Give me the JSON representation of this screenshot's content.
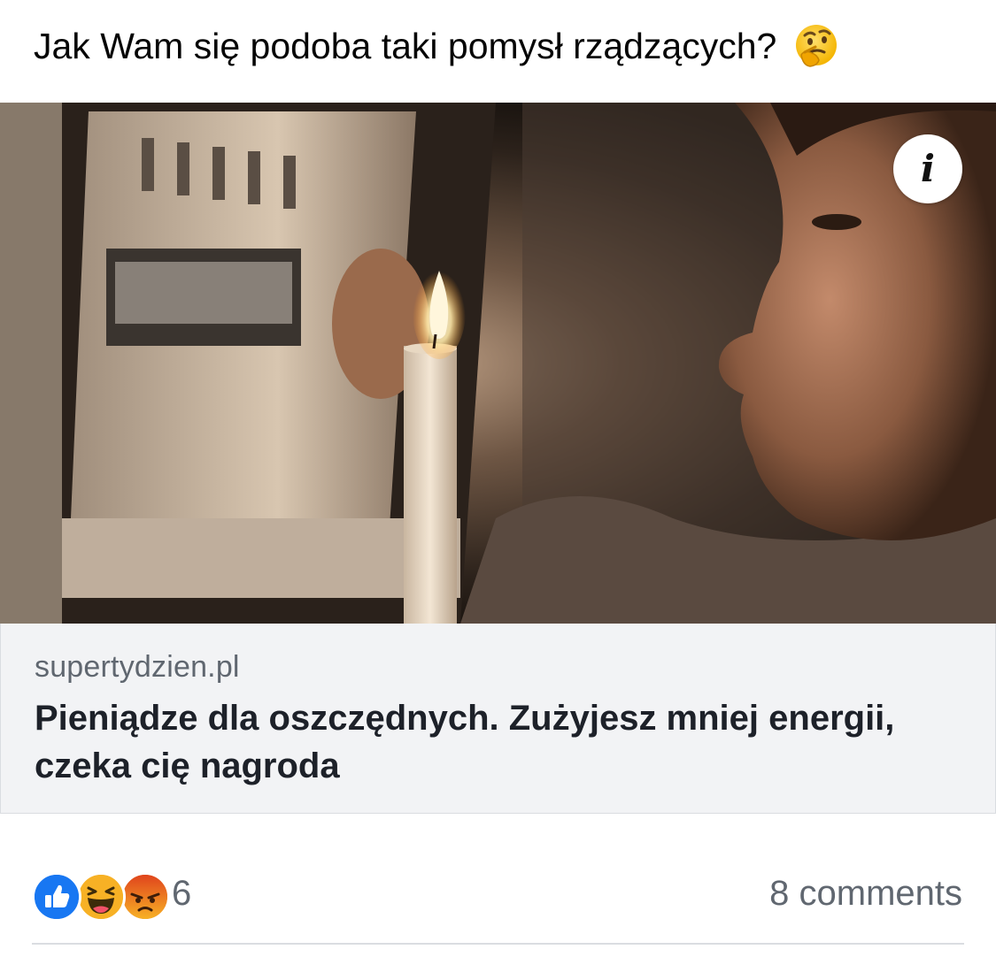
{
  "post": {
    "text": "Jak Wam się podoba taki pomysł rządzących?",
    "emoji": "thinking-face-icon"
  },
  "link_card": {
    "image_description_icon": "info-icon",
    "info_label": "i",
    "domain": "supertydzien.pl",
    "title": "Pieniądze dla oszczędnych. Zużyjesz mniej energii, czeka cię nagroda"
  },
  "reactions": {
    "icons": [
      "like-icon",
      "haha-icon",
      "angry-icon"
    ],
    "count": "6",
    "comments_label": "8 comments"
  },
  "colors": {
    "like": "#1877f2",
    "haha": "#f7b125",
    "angry": "#e9710f",
    "secondary_text": "#606770",
    "card_bg": "#f2f3f5"
  }
}
